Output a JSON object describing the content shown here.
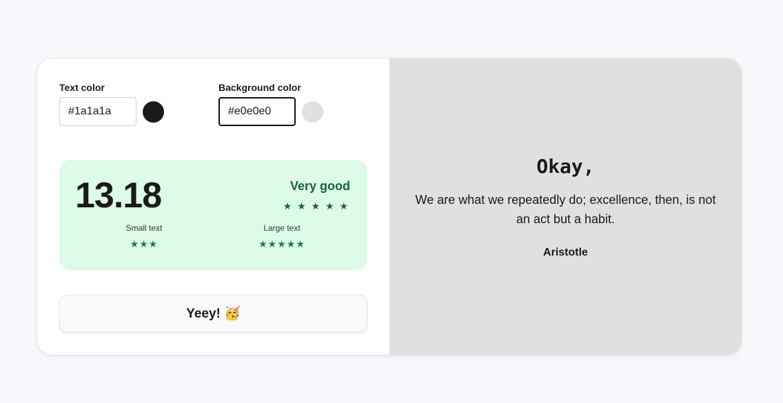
{
  "controls": {
    "text_color": {
      "label": "Text color",
      "value": "#1a1a1a",
      "swatch": "#1a1a1a"
    },
    "background_color": {
      "label": "Background color",
      "value": "#e0e0e0",
      "swatch": "#e0e0e0"
    }
  },
  "score": {
    "value": "13.18",
    "rating": "Very good",
    "rating_stars": "★ ★ ★ ★ ★",
    "small_text": {
      "label": "Small text",
      "stars": "★★★"
    },
    "large_text": {
      "label": "Large text",
      "stars": "★★★★★"
    }
  },
  "action": {
    "label": "Yeey! 🥳"
  },
  "preview": {
    "title": "Okay,",
    "quote": "We are what we repeatedly do; excellence, then, is not an act but a habit.",
    "author": "Aristotle"
  },
  "colors": {
    "score_bg": "#dcfce7",
    "rating_green": "#166534",
    "preview_bg": "#e0e0e0",
    "text": "#1a1a1a"
  }
}
